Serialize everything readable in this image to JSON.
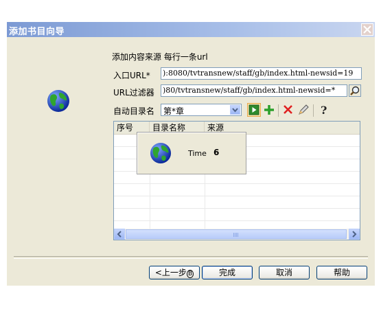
{
  "window": {
    "title": "添加书目向导"
  },
  "form": {
    "heading": "添加内容来源  每行一条url",
    "entry_url_label": "入口URL*",
    "entry_url_value": "):8080/tvtransnew/staff/gb/index.html-newsid=19",
    "url_filter_label": "URL过滤器",
    "url_filter_value": ")80/tvtransnew/staff/gb/index.html-newsid=*",
    "auto_dir_label": "自动目录名",
    "auto_dir_value": "第*章"
  },
  "toolbar": {
    "icons": [
      "play-icon",
      "add-icon",
      "delete-icon",
      "edit-icon",
      "help-icon"
    ],
    "colors": {
      "play": "#2E8B2E",
      "add": "#2BA02B",
      "delete": "#E02020",
      "help": "#333333"
    }
  },
  "grid": {
    "columns": [
      "序号",
      "目录名称",
      "来源"
    ],
    "rows": []
  },
  "popup": {
    "label": "Time",
    "value": "6"
  },
  "buttons": {
    "back_label": "上一步",
    "back_key": "B",
    "finish_label": "完成",
    "cancel_label": "取消",
    "help_label": "帮助"
  }
}
